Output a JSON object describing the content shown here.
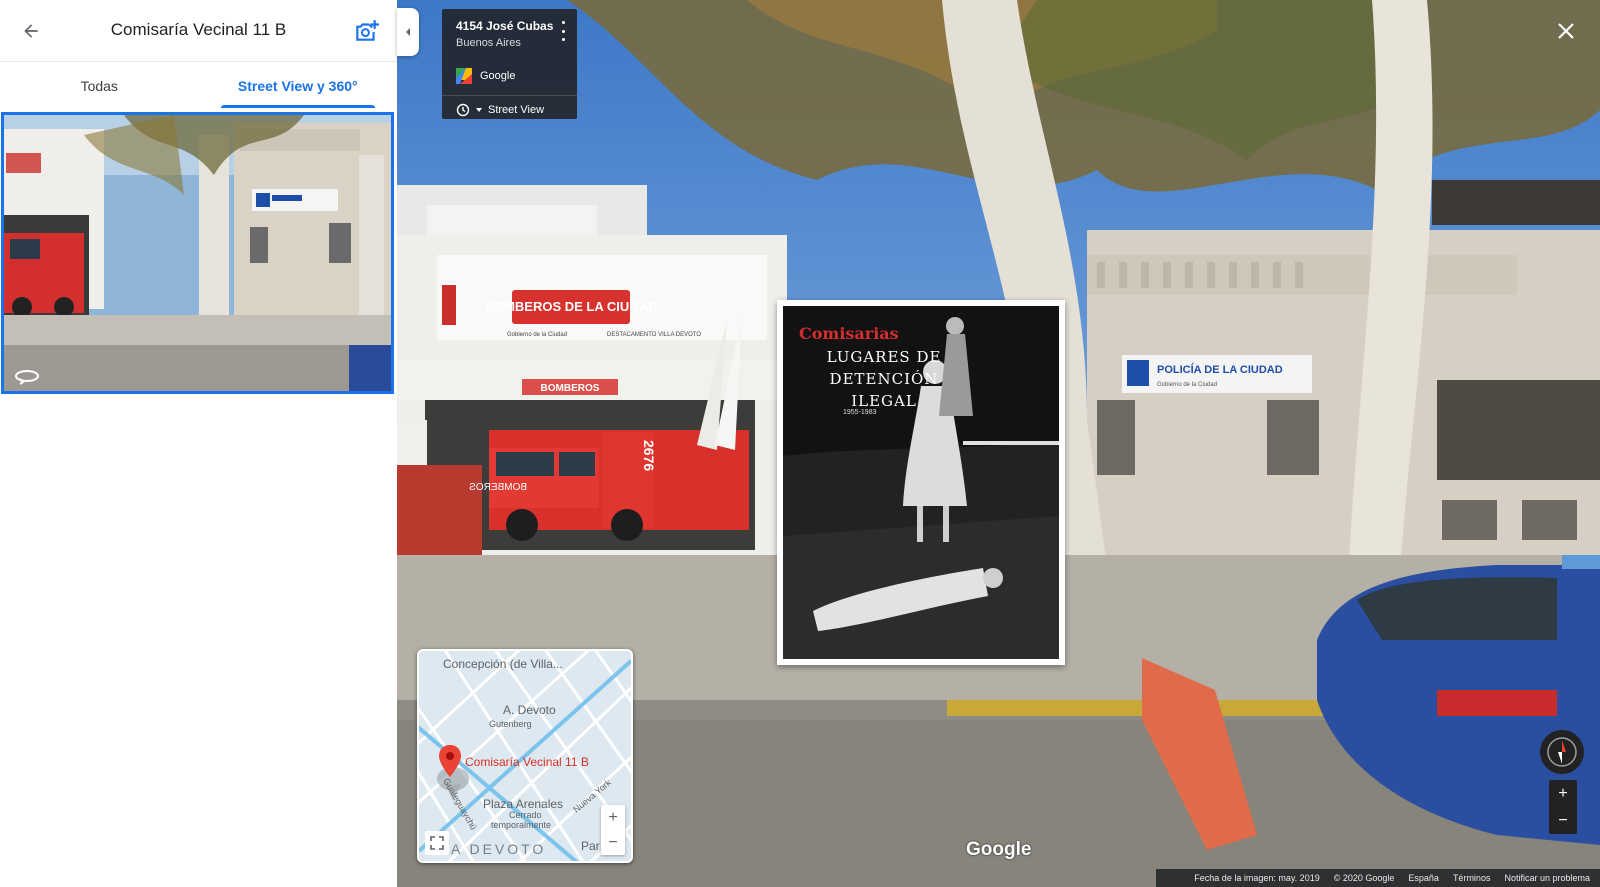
{
  "panel": {
    "title": "Comisaría Vecinal 11 B",
    "tabs": [
      {
        "label": "Todas",
        "active": false
      },
      {
        "label": "Street View y 360°",
        "active": true
      }
    ]
  },
  "scene": {
    "firehouse_sign": "BOMBEROS DE LA CIUDAD",
    "firehouse_sub_left": "Gobierno de la Ciudad",
    "firehouse_sub_right": "DESTACAMENTO VILLA DEVOTO",
    "firehouse_door_sign": "BOMBEROS",
    "truck_number": "2676",
    "truck_front_text": "BOMBEROS",
    "police_sign": "POLICÍA DE LA CIUDAD",
    "police_sub": "Gobierno de la Ciudad"
  },
  "address_card": {
    "street": "4154 José Cubas",
    "city": "Buenos Aires",
    "source": "Google",
    "time_label": "Street View"
  },
  "poster": {
    "title": "Comisarias",
    "line1": "LUGARES DE",
    "line2": "DETENCIÓN",
    "line3": "ILEGAL",
    "years": "1955-1983"
  },
  "mini_map": {
    "labels": {
      "concepcion": "Concepción (de Villa...",
      "devoto_plaza": "A. Devoto",
      "gutenberg": "Gutenberg",
      "place": "Comisaría Vecinal 11 B",
      "plaza_arenales": "Plaza Arenales",
      "cerrado": "Cerrado",
      "temporalmente": "temporalmente",
      "nueva_york": "Nueva York",
      "devoto_area": "A DEVOTO",
      "par": "Par",
      "gualeguaychu": "Gualeguaychú"
    },
    "zoom_in": "+",
    "zoom_out": "−"
  },
  "watermark": "Google",
  "sv_zoom": {
    "in": "+",
    "out": "−"
  },
  "footer": {
    "date": "Fecha de la imagen: may. 2019",
    "copyright": "© 2020 Google",
    "country": "España",
    "terms": "Términos",
    "report": "Notificar un problema"
  },
  "colors": {
    "accent": "#1a73e8",
    "firehouse_red": "#d32f2f",
    "police_blue": "#1e4fa8",
    "pin_red": "#ea4335"
  }
}
